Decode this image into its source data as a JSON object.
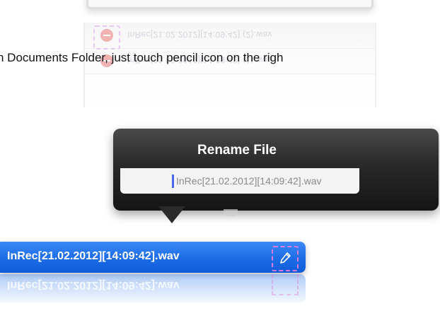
{
  "instruction_text": "n Documents Folder, just touch pencil icon on the righ",
  "background_list": {
    "rows": [
      {
        "label": "InRec[21.02.2012][14:09:42] (2).wav"
      },
      {
        "label": "InRec[21.02.2012][14:09:42] (1).wav"
      }
    ]
  },
  "rename_popover": {
    "title": "Rename File",
    "field_value": "InRec[21.02.2012][14:09:42].wav"
  },
  "file_row": {
    "name": "InRec[21.02.2012][14:09:42].wav",
    "action_icon": "pencil-icon"
  },
  "colors": {
    "row_blue": "#1e6ee8",
    "popover_dark": "#151515",
    "highlight_dash": "#e07ad8",
    "cursor_blue": "#4668e8"
  }
}
